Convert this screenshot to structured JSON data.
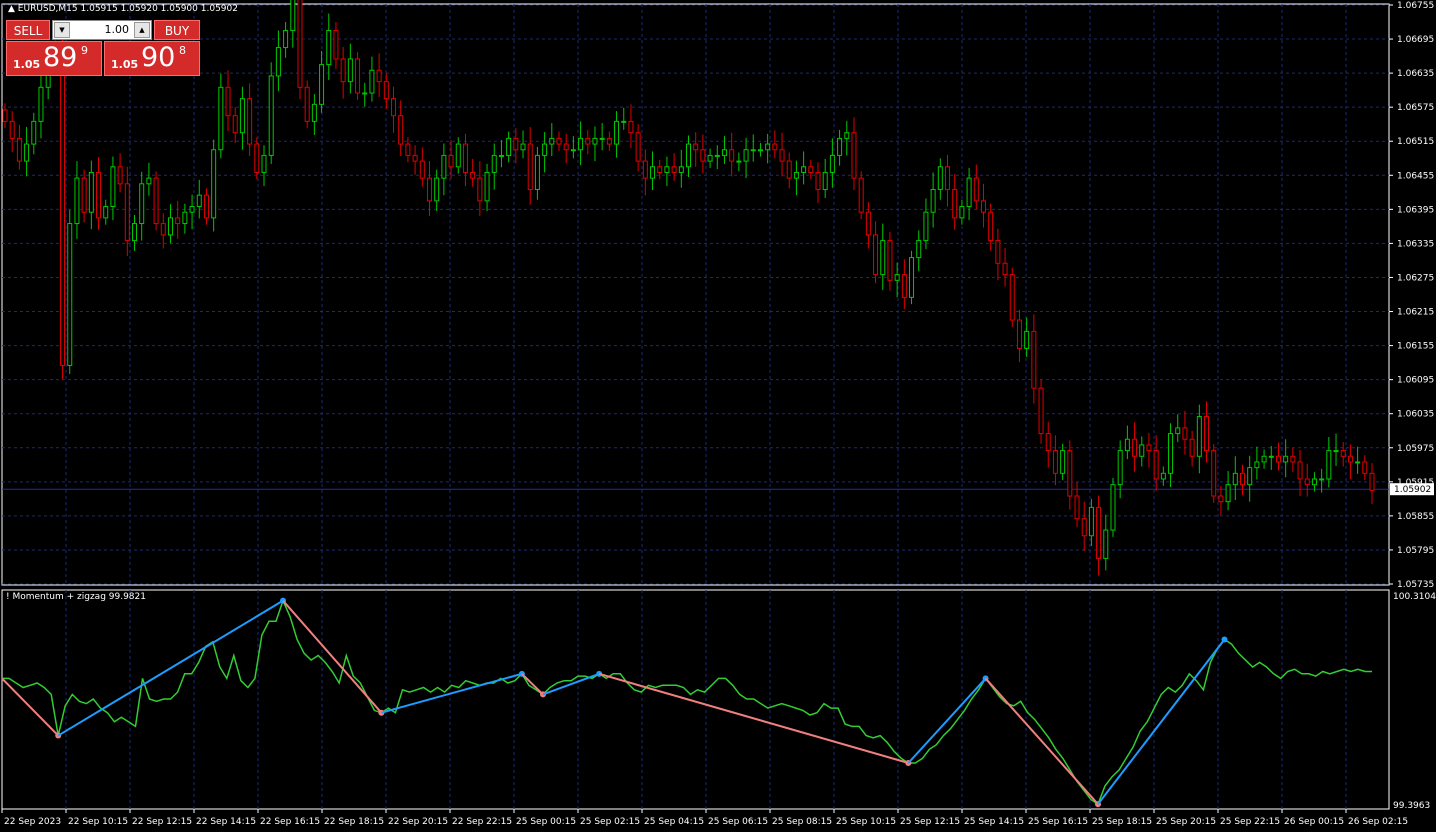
{
  "header": {
    "symbol_label": "EURUSD,M15",
    "ohlc": "1.05915 1.05920 1.05900 1.05902"
  },
  "trade_panel": {
    "sell_label": "SELL",
    "buy_label": "BUY",
    "lot_value": "1.00",
    "sell_prefix": "1.05",
    "sell_big": "89",
    "sell_sup": "9",
    "buy_prefix": "1.05",
    "buy_big": "90",
    "buy_sup": "8"
  },
  "indicator": {
    "title": "! Momentum + zigzag 99.9821"
  },
  "colors": {
    "background": "#000000",
    "grid": "#1e2a6e",
    "bull": "#00c800",
    "bear": "#e00000",
    "momentum": "#32cd32",
    "zigzag_up": "#1e9cff",
    "zigzag_down": "#f08080",
    "price_line": "#2030a0"
  },
  "chart_data": [
    {
      "type": "candlestick",
      "symbol": "EURUSD",
      "timeframe": "M15",
      "ylim": [
        1.05735,
        1.06755
      ],
      "y_ticks": [
        "1.06755",
        "1.06695",
        "1.06635",
        "1.06575",
        "1.06515",
        "1.06455",
        "1.06395",
        "1.06335",
        "1.06275",
        "1.06215",
        "1.06155",
        "1.06095",
        "1.06035",
        "1.05975",
        "1.05915",
        "1.05855",
        "1.05795",
        "1.05735"
      ],
      "current_price": "1.05902",
      "x_ticks": [
        "22 Sep 2023",
        "22 Sep 10:15",
        "22 Sep 12:15",
        "22 Sep 14:15",
        "22 Sep 16:15",
        "22 Sep 18:15",
        "22 Sep 20:15",
        "22 Sep 22:15",
        "25 Sep 00:15",
        "25 Sep 02:15",
        "25 Sep 04:15",
        "25 Sep 06:15",
        "25 Sep 08:15",
        "25 Sep 10:15",
        "25 Sep 12:15",
        "25 Sep 14:15",
        "25 Sep 16:15",
        "25 Sep 18:15",
        "25 Sep 20:15",
        "25 Sep 22:15",
        "26 Sep 00:15",
        "26 Sep 02:15"
      ],
      "closes": [
        1.0655,
        1.0652,
        1.0648,
        1.0651,
        1.0655,
        1.0661,
        1.0665,
        1.0668,
        1.0612,
        1.0637,
        1.0645,
        1.0639,
        1.0646,
        1.0638,
        1.064,
        1.0647,
        1.0644,
        1.0634,
        1.0637,
        1.0644,
        1.0645,
        1.0637,
        1.0635,
        1.0638,
        1.0637,
        1.0639,
        1.064,
        1.0642,
        1.0638,
        1.065,
        1.0661,
        1.0656,
        1.0653,
        1.0659,
        1.0651,
        1.0646,
        1.0649,
        1.0663,
        1.0668,
        1.0671,
        1.0681,
        1.0661,
        1.0655,
        1.0658,
        1.0665,
        1.0671,
        1.0666,
        1.0662,
        1.0666,
        1.066,
        1.066,
        1.0664,
        1.0662,
        1.0659,
        1.0656,
        1.0651,
        1.0649,
        1.0648,
        1.0645,
        1.0641,
        1.0645,
        1.0649,
        1.0647,
        1.0651,
        1.0646,
        1.0645,
        1.0641,
        1.0646,
        1.0649,
        1.0649,
        1.0652,
        1.065,
        1.0651,
        1.0643,
        1.0649,
        1.0651,
        1.0652,
        1.0651,
        1.065,
        1.065,
        1.0652,
        1.0651,
        1.0652,
        1.0652,
        1.0651,
        1.0655,
        1.0655,
        1.0653,
        1.0648,
        1.0645,
        1.0647,
        1.0646,
        1.0647,
        1.0646,
        1.0647,
        1.0651,
        1.065,
        1.0648,
        1.0649,
        1.0649,
        1.065,
        1.0648,
        1.0648,
        1.065,
        1.065,
        1.065,
        1.0651,
        1.065,
        1.0648,
        1.0645,
        1.0646,
        1.0647,
        1.0646,
        1.0643,
        1.0646,
        1.0649,
        1.0652,
        1.0653,
        1.0645,
        1.0639,
        1.0635,
        1.0628,
        1.0634,
        1.0627,
        1.0628,
        1.0624,
        1.0631,
        1.0634,
        1.0639,
        1.0643,
        1.0647,
        1.0643,
        1.0638,
        1.064,
        1.0645,
        1.0641,
        1.0639,
        1.0634,
        1.063,
        1.0628,
        1.062,
        1.0615,
        1.0618,
        1.0608,
        1.06,
        1.0597,
        1.0593,
        1.0597,
        1.0589,
        1.0585,
        1.0582,
        1.0587,
        1.0578,
        1.0583,
        1.0591,
        1.0597,
        1.0599,
        1.0596,
        1.0598,
        1.0597,
        1.0592,
        1.0593,
        1.06,
        1.0601,
        1.0599,
        1.0596,
        1.0603,
        1.0597,
        1.0589,
        1.0588,
        1.0591,
        1.0593,
        1.0591,
        1.0594,
        1.0595,
        1.0596,
        1.0596,
        1.0595,
        1.0596,
        1.0595,
        1.0592,
        1.0591,
        1.0592,
        1.0592,
        1.0597,
        1.0597,
        1.0596,
        1.0595,
        1.0595,
        1.0593,
        1.059
      ]
    },
    {
      "type": "line",
      "name": "Momentum + zigzag",
      "current_value": "99.9821",
      "ylim": [
        99.3963,
        100.3104
      ],
      "y_ticks": [
        "100.3104",
        "99.3963"
      ],
      "momentum": [
        99.95,
        99.95,
        99.93,
        99.91,
        99.92,
        99.93,
        99.91,
        99.88,
        99.7,
        99.83,
        99.88,
        99.85,
        99.84,
        99.86,
        99.82,
        99.8,
        99.76,
        99.78,
        99.76,
        99.74,
        99.95,
        99.86,
        99.85,
        99.86,
        99.86,
        99.89,
        99.97,
        99.97,
        100.02,
        100.09,
        100.11,
        100.0,
        99.95,
        100.05,
        99.94,
        99.91,
        99.95,
        100.14,
        100.2,
        100.2,
        100.29,
        100.22,
        100.12,
        100.06,
        100.03,
        100.05,
        100.02,
        99.98,
        99.93,
        100.05,
        99.96,
        99.93,
        99.87,
        99.81,
        99.8,
        99.82,
        99.8,
        99.9,
        99.89,
        99.9,
        99.91,
        99.89,
        99.91,
        99.89,
        99.92,
        99.91,
        99.94,
        99.93,
        99.92,
        99.93,
        99.93,
        99.95,
        99.93,
        99.94,
        99.97,
        99.92,
        99.9,
        99.88,
        99.91,
        99.93,
        99.94,
        99.94,
        99.96,
        99.96,
        99.95,
        99.97,
        99.95,
        99.97,
        99.97,
        99.93,
        99.9,
        99.89,
        99.92,
        99.91,
        99.92,
        99.92,
        99.92,
        99.91,
        99.88,
        99.9,
        99.89,
        99.92,
        99.95,
        99.95,
        99.92,
        99.88,
        99.86,
        99.86,
        99.84,
        99.82,
        99.83,
        99.84,
        99.83,
        99.82,
        99.81,
        99.79,
        99.8,
        99.84,
        99.82,
        99.82,
        99.75,
        99.74,
        99.74,
        99.7,
        99.69,
        99.7,
        99.67,
        99.63,
        99.6,
        99.58,
        99.58,
        99.6,
        99.64,
        99.66,
        99.7,
        99.73,
        99.77,
        99.81,
        99.86,
        99.9,
        99.95,
        99.91,
        99.87,
        99.84,
        99.83,
        99.85,
        99.8,
        99.77,
        99.73,
        99.69,
        99.64,
        99.6,
        99.55,
        99.5,
        99.46,
        99.42,
        99.4,
        99.48,
        99.52,
        99.55,
        99.6,
        99.65,
        99.72,
        99.76,
        99.82,
        99.88,
        99.91,
        99.89,
        99.92,
        99.97,
        99.94,
        99.9,
        100.02,
        100.08,
        100.12,
        100.1,
        100.06,
        100.03,
        100.0,
        100.02,
        100.0,
        99.97,
        99.95,
        99.98,
        99.99,
        99.97,
        99.97,
        99.96,
        99.98,
        99.97,
        99.98,
        99.99,
        99.98,
        99.99,
        99.98,
        99.98
      ]
    }
  ]
}
